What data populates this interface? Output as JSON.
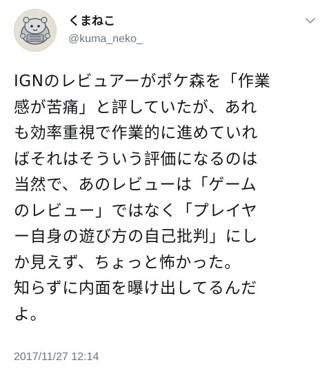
{
  "user": {
    "display_name": "くまねこ",
    "handle": "@kuma_neko_",
    "avatar_icon": "bear-cat-avatar-icon"
  },
  "menu": {
    "icon": "chevron-down-icon"
  },
  "tweet": {
    "lines": [
      "IGNのレビュアーがポケ森を「作業",
      "感が苦痛」と評していたが、あれ",
      "も効率重視で作業的に進めていれ",
      "ばそれはそういう評価になるのは",
      "当然で、あのレビューは「ゲーム",
      "のレビュー」ではなく「プレイヤ",
      "ー自身の遊び方の自己批判」にし",
      "か見えず、ちょっと怖かった。",
      "知らずに内面を曝け出してるんだ",
      "よ。"
    ],
    "timestamp": "2017/11/27 12:14"
  }
}
